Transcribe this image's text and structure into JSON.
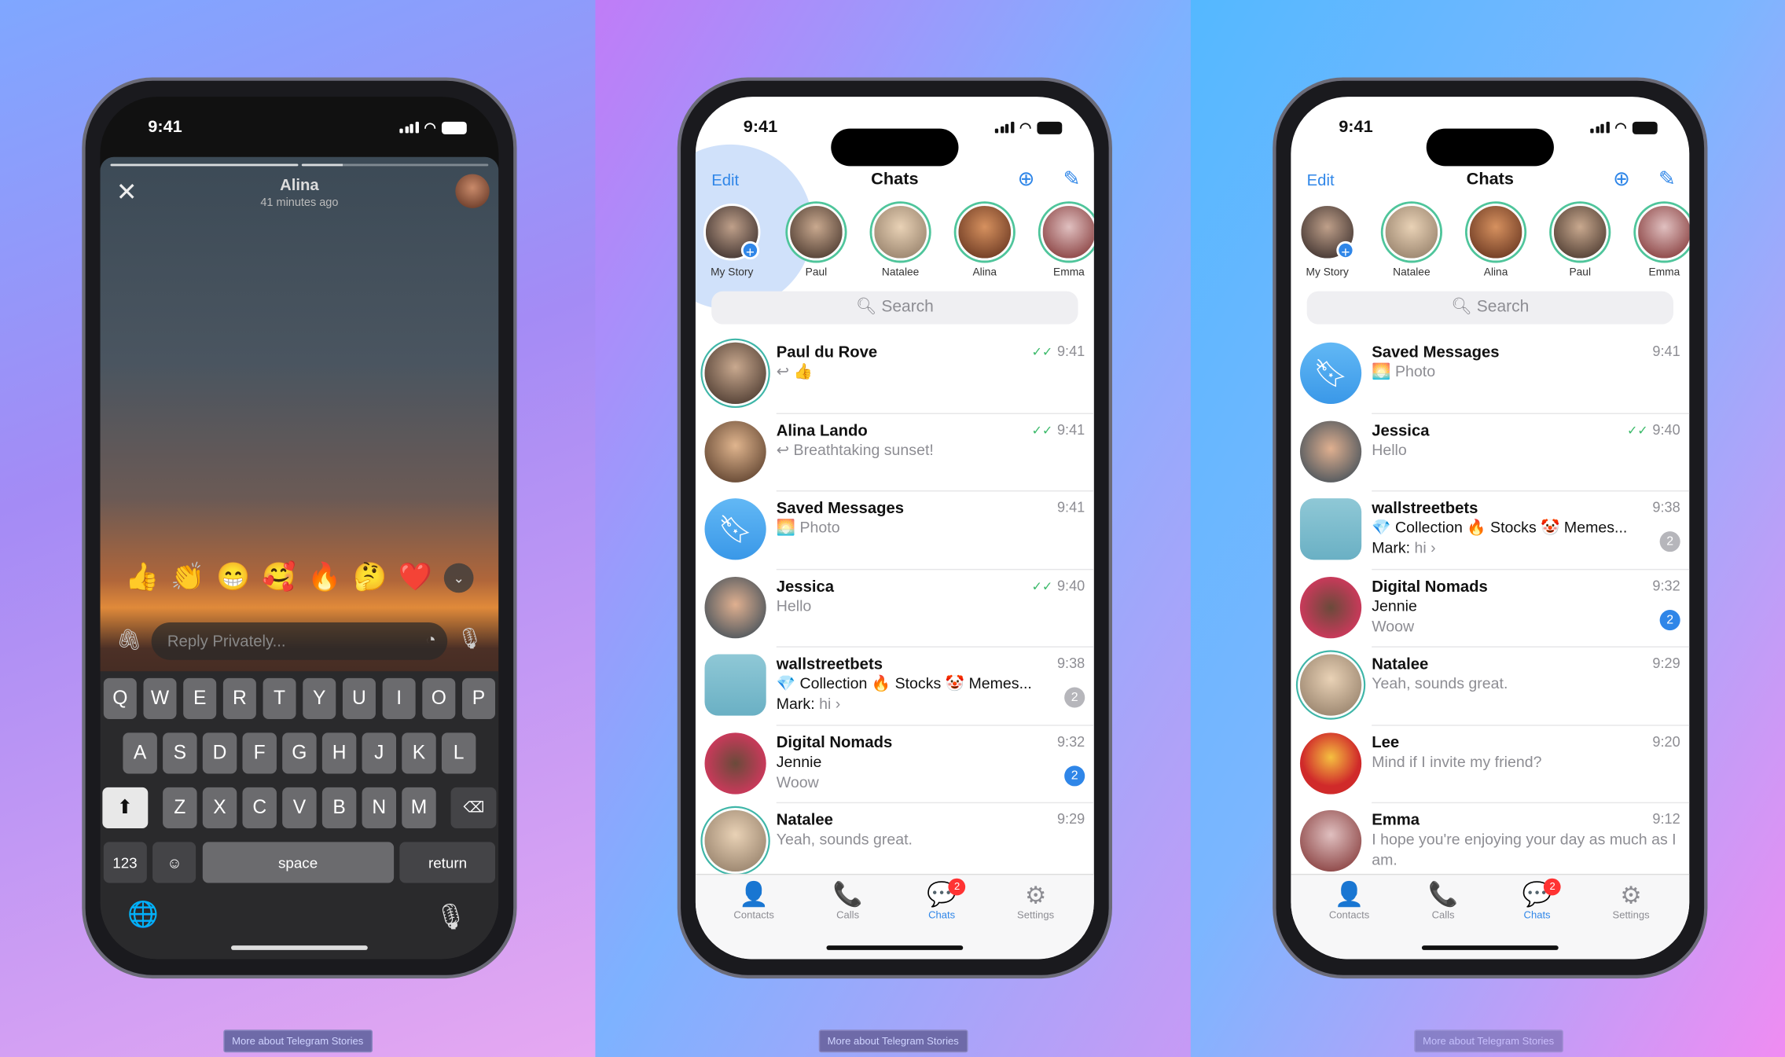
{
  "footer_link": "More about Telegram Stories",
  "colors": {
    "accent": "#2f86e8",
    "unread_badge": "#2f86e8",
    "muted_badge": "#b6b6bb",
    "story_ring": "#3fb6a8",
    "tab_badge": "#ff3333"
  },
  "story_viewer": {
    "time": "9:41",
    "name": "Alina",
    "subtitle": "41 minutes ago",
    "reactions": [
      "👍",
      "👏",
      "😁",
      "🥰",
      "🔥",
      "🤔",
      "❤️"
    ],
    "reply_placeholder": "Reply Privately...",
    "keyboard": {
      "row1": [
        "Q",
        "W",
        "E",
        "R",
        "T",
        "Y",
        "U",
        "I",
        "O",
        "P"
      ],
      "row2": [
        "A",
        "S",
        "D",
        "F",
        "G",
        "H",
        "J",
        "K",
        "L"
      ],
      "row3": [
        "Z",
        "X",
        "C",
        "V",
        "B",
        "N",
        "M"
      ],
      "numbers": "123",
      "space": "space",
      "return": "return"
    }
  },
  "chat_screens": [
    {
      "time": "9:41",
      "edit": "Edit",
      "title": "Chats",
      "search": "Search",
      "stories": [
        "My Story",
        "Paul",
        "Natalee",
        "Alina",
        "Emma"
      ],
      "chats": [
        {
          "name": "Paul du Rove",
          "time": "9:41",
          "read": true,
          "line1": "↩ 👍",
          "ring": true
        },
        {
          "name": "Alina Lando",
          "time": "9:41",
          "read": true,
          "line1": "↩ Breathtaking sunset!",
          "ring": false
        },
        {
          "name": "Saved Messages",
          "time": "9:41",
          "line1": "🌅 Photo",
          "saved": true
        },
        {
          "name": "Jessica",
          "time": "9:40",
          "read": true,
          "line1": "Hello"
        },
        {
          "name": "wallstreetbets",
          "time": "9:38",
          "line1": "💎 Collection 🔥 Stocks 🤡 Memes...",
          "sender": "Mark:",
          "line2": "hi ›",
          "badge": "2",
          "muted": true,
          "square": true
        },
        {
          "name": "Digital Nomads",
          "time": "9:32",
          "line1": "Jennie",
          "line2": "Woow",
          "badge": "2",
          "dark1": true
        },
        {
          "name": "Natalee",
          "time": "9:29",
          "line1": "Yeah, sounds great.",
          "ring": true
        }
      ],
      "tabs": [
        {
          "label": "Contacts",
          "icon": "👤"
        },
        {
          "label": "Calls",
          "icon": "📞"
        },
        {
          "label": "Chats",
          "icon": "💬",
          "badge": "2",
          "active": true
        },
        {
          "label": "Settings",
          "icon": "⚙"
        }
      ]
    },
    {
      "time": "9:41",
      "edit": "Edit",
      "title": "Chats",
      "search": "Search",
      "stories": [
        "My Story",
        "Natalee",
        "Alina",
        "Paul",
        "Emma"
      ],
      "chats": [
        {
          "name": "Saved Messages",
          "time": "9:41",
          "line1": "🌅 Photo",
          "saved": true
        },
        {
          "name": "Jessica",
          "time": "9:40",
          "read": true,
          "line1": "Hello"
        },
        {
          "name": "wallstreetbets",
          "time": "9:38",
          "line1": "💎 Collection 🔥 Stocks 🤡 Memes...",
          "sender": "Mark:",
          "line2": "hi ›",
          "badge": "2",
          "muted": true,
          "square": true
        },
        {
          "name": "Digital Nomads",
          "time": "9:32",
          "line1": "Jennie",
          "line2": "Woow",
          "badge": "2",
          "dark1": true
        },
        {
          "name": "Natalee",
          "time": "9:29",
          "line1": "Yeah, sounds great.",
          "ring": true
        },
        {
          "name": "Lee",
          "time": "9:20",
          "line1": "Mind if I invite my friend?"
        },
        {
          "name": "Emma",
          "time": "9:12",
          "line1": "I hope you're enjoying your day as much as I",
          "line2": "am."
        }
      ],
      "tabs": [
        {
          "label": "Contacts",
          "icon": "👤"
        },
        {
          "label": "Calls",
          "icon": "📞"
        },
        {
          "label": "Chats",
          "icon": "💬",
          "badge": "2",
          "active": true
        },
        {
          "label": "Settings",
          "icon": "⚙"
        }
      ]
    }
  ]
}
